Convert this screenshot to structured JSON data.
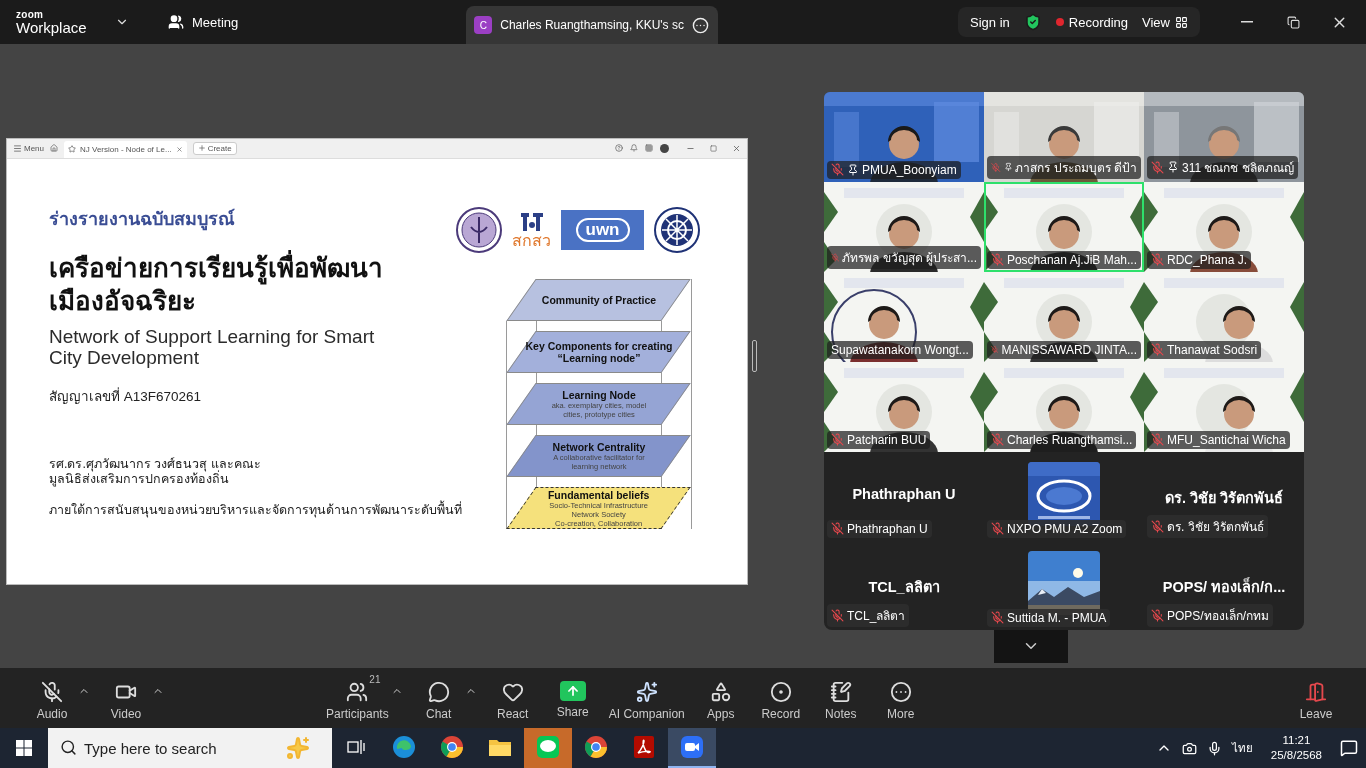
{
  "title_bar": {
    "logo_top": "zoom",
    "logo_bottom": "Workplace",
    "meeting": "Meeting",
    "share_tab": {
      "initial": "C",
      "label": "Charles Ruangthamsing, KKU's sc"
    },
    "sign_in": "Sign in",
    "recording": "Recording",
    "view": "View"
  },
  "shared_screen": {
    "browser": {
      "menu": "Menu",
      "tab": "NJ Version - Node of Le...",
      "create": "Create"
    },
    "slide": {
      "kicker": "ร่างรายงานฉบับสมบูรณ์",
      "title_lines": [
        "เครือข่ายการเรียนรู้เพื่อพัฒนา",
        "เมืองอัจฉริยะ"
      ],
      "english_lines": [
        "Network of Support Learning for Smart",
        "City Development"
      ],
      "contract": "สัญญาเลขที่ A13F670261",
      "authors": [
        "รศ.ดร.ศุภวัฒนากร วงศ์ธนวสุ และคณะ",
        "มูลนิธิส่งเสริมการปกครองท้องถิ่น"
      ],
      "support": "ภายใต้การสนับสนุนของหน่วยบริหารและจัดการทุนด้านการพัฒนาระดับพื้นที่",
      "logos": [
        {
          "kind": "seal"
        },
        {
          "kind": "wordmark",
          "text": "สกสว"
        },
        {
          "kind": "banner",
          "text": "uwn"
        },
        {
          "kind": "wheel"
        }
      ],
      "layers": [
        {
          "kind": "solid",
          "color": "#b7c1e0",
          "title": "Community of Practice"
        },
        {
          "kind": "solid",
          "color": "#a3b0db",
          "title": "Key Components for creating “Learning node”"
        },
        {
          "kind": "solid",
          "color": "#95a4d4",
          "title": "Learning Node",
          "lines": [
            "aka. exemplary cities, model",
            "cities, prototype cities"
          ]
        },
        {
          "kind": "solid",
          "color": "#8394cb",
          "title": "Network Centrality",
          "lines": [
            "A collaborative facilitator for",
            "learning network"
          ]
        },
        {
          "kind": "dashed",
          "color": "#f5e17c",
          "title": "Fundamental beliefs",
          "lines": [
            "Socio-Technical Infrastructure",
            "Network Society",
            "Co-creation, Collaboration"
          ]
        }
      ]
    }
  },
  "participants": {
    "video_tiles": [
      {
        "name": "PMUA_Boonyiam",
        "muted": true,
        "pinned": true,
        "speaking": false
      },
      {
        "name": "ภาสกร ประถมบุตร ดีป้า",
        "muted": true,
        "pinned": true,
        "speaking": false
      },
      {
        "name": "311 ชณกช ชลิตภณญ์",
        "muted": true,
        "pinned": true,
        "speaking": false
      },
      {
        "name": "ภัทรพล ขวัญสุด ผู้ประสา...",
        "muted": true,
        "pinned": false,
        "speaking": false
      },
      {
        "name": "Poschanan Aj.JiB Mah...",
        "muted": true,
        "pinned": false,
        "speaking": true
      },
      {
        "name": "RDC_Phana J.",
        "muted": true,
        "pinned": false,
        "speaking": false
      },
      {
        "name": "Supawatanakorn Wongt...",
        "muted": false,
        "pinned": false,
        "speaking": false
      },
      {
        "name": "MANISSAWARD JINTA...",
        "muted": true,
        "pinned": false,
        "speaking": false
      },
      {
        "name": "Thanawat Sodsri",
        "muted": true,
        "pinned": false,
        "speaking": false
      },
      {
        "name": "Patcharin BUU",
        "muted": true,
        "pinned": false,
        "speaking": false
      },
      {
        "name": "Charles Ruangthamsi...",
        "muted": true,
        "pinned": false,
        "speaking": false
      },
      {
        "name": "MFU_Santichai Wicha",
        "muted": true,
        "pinned": false,
        "speaking": false
      }
    ],
    "avatar_tiles": [
      {
        "kind": "name",
        "display_name": "Phathraphan U",
        "name": "Phathraphan U",
        "muted": true
      },
      {
        "kind": "picture",
        "name": "NXPO PMU A2 Zoom",
        "muted": true
      },
      {
        "kind": "name",
        "display_name": "ดร. วิชัย วิรัตกพันธ์",
        "name": "ดร. วิชัย วิรัตกพันธ์",
        "muted": true
      },
      {
        "kind": "name",
        "display_name": "TCL_ลลิตา",
        "name": "TCL_ลลิตา",
        "muted": true
      },
      {
        "kind": "picture",
        "name": "Suttida M. - PMUA",
        "muted": true
      },
      {
        "kind": "name",
        "display_name": "POPS/ ทองเล็ก/ก...",
        "name": "POPS/ทองเล็ก/กทม",
        "muted": true
      }
    ]
  },
  "toolbar": {
    "left": [
      {
        "kind": "audio",
        "label": "Audio",
        "muted": true,
        "caret": true
      },
      {
        "kind": "video",
        "label": "Video",
        "caret": true
      }
    ],
    "center": [
      {
        "kind": "participants",
        "label": "Participants",
        "badge": "21",
        "caret": true
      },
      {
        "kind": "chat",
        "label": "Chat",
        "caret": true
      },
      {
        "kind": "react",
        "label": "React",
        "caret": false
      },
      {
        "kind": "share",
        "label": "Share",
        "caret": false
      },
      {
        "kind": "ai",
        "label": "AI Companion",
        "caret": false
      },
      {
        "kind": "apps",
        "label": "Apps",
        "caret": false
      },
      {
        "kind": "record",
        "label": "Record",
        "caret": false
      },
      {
        "kind": "notes",
        "label": "Notes",
        "caret": false
      },
      {
        "kind": "more",
        "label": "More",
        "caret": false
      }
    ],
    "leave": "Leave"
  },
  "taskbar": {
    "search_placeholder": "Type here to search",
    "apps": [
      {
        "kind": "taskview",
        "selected": false,
        "flashing": false
      },
      {
        "kind": "edge",
        "selected": false,
        "flashing": false
      },
      {
        "kind": "chrome",
        "selected": false,
        "flashing": false
      },
      {
        "kind": "files",
        "selected": false,
        "flashing": false
      },
      {
        "kind": "line",
        "selected": false,
        "flashing": true
      },
      {
        "kind": "chrome",
        "selected": false,
        "flashing": false
      },
      {
        "kind": "acrobat",
        "selected": false,
        "flashing": false
      },
      {
        "kind": "zoom",
        "selected": true,
        "flashing": false
      }
    ],
    "language": "ไทย",
    "time": "11:21",
    "date": "25/8/2568"
  }
}
